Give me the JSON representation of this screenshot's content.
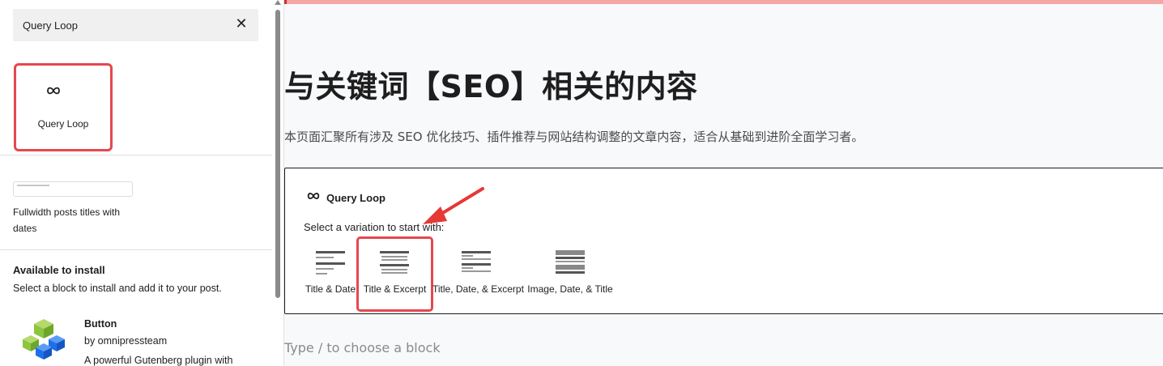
{
  "inserter": {
    "search": {
      "value": "Query Loop",
      "clear_icon": "close-icon"
    },
    "result": {
      "label": "Query Loop",
      "icon": "loop-icon"
    },
    "pattern": {
      "label": "Fullwidth posts titles with dates"
    },
    "available": {
      "title": "Available to install",
      "subtitle": "Select a block to install and add it to your post.",
      "plugin": {
        "name": "Button",
        "author": "by omnipressteam",
        "description": "A powerful Gutenberg plugin with"
      }
    }
  },
  "editor": {
    "title": "与关键词【SEO】相关的内容",
    "description": "本页面汇聚所有涉及 SEO 优化技巧、插件推荐与网站结构调整的文章内容，适合从基础到进阶全面学习者。",
    "placeholder": {
      "title": "Query Loop",
      "instruction": "Select a variation to start with:",
      "variations": [
        {
          "label": "Title & Date"
        },
        {
          "label": "Title & Excerpt"
        },
        {
          "label": "Title, Date, & Excerpt"
        },
        {
          "label": "Image, Date, & Title"
        }
      ]
    },
    "appender": "Type / to choose a block"
  },
  "colors": {
    "highlight": "#e5484d",
    "top_bar": "#f4a5a5",
    "plugin_green": "#8cc63f",
    "plugin_blue": "#1e6fe8"
  }
}
